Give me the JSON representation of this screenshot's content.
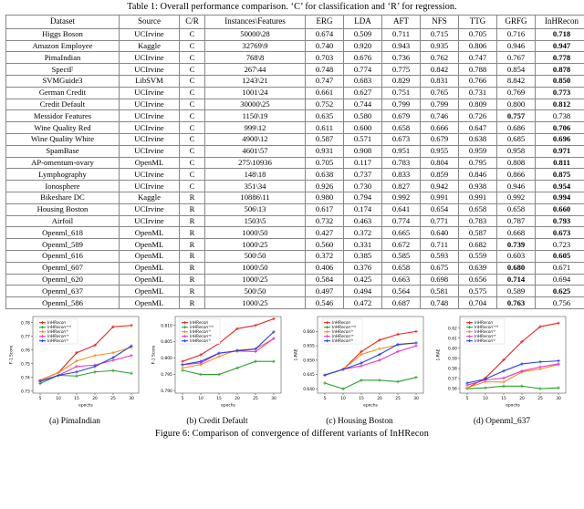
{
  "table": {
    "caption": "Table 1: Overall performance comparison. ‘C’ for classification and ‘R’ for regression.",
    "columns": [
      "Dataset",
      "Source",
      "C/R",
      "Instances\\Features",
      "ERG",
      "LDA",
      "AFT",
      "NFS",
      "TTG",
      "GRFG",
      "InHRecon"
    ],
    "rows": [
      {
        "cells": [
          "Higgs Boson",
          "UCIrvine",
          "C",
          "50000\\28",
          "0.674",
          "0.509",
          "0.711",
          "0.715",
          "0.705",
          "0.716",
          "0.718"
        ],
        "bold": [
          10
        ]
      },
      {
        "cells": [
          "Amazon Employee",
          "Kaggle",
          "C",
          "32769\\9",
          "0.740",
          "0.920",
          "0.943",
          "0.935",
          "0.806",
          "0.946",
          "0.947"
        ],
        "bold": [
          10
        ]
      },
      {
        "cells": [
          "PimaIndian",
          "UCIrvine",
          "C",
          "768\\8",
          "0.703",
          "0.676",
          "0.736",
          "0.762",
          "0.747",
          "0.767",
          "0.778"
        ],
        "bold": [
          10
        ]
      },
      {
        "cells": [
          "SpectF",
          "UCIrvine",
          "C",
          "267\\44",
          "0.748",
          "0.774",
          "0.775",
          "0.842",
          "0.788",
          "0.854",
          "0.878"
        ],
        "bold": [
          10
        ]
      },
      {
        "cells": [
          "SVMGuide3",
          "LibSVM",
          "C",
          "1243\\21",
          "0.747",
          "0.683",
          "0.829",
          "0.831",
          "0.766",
          "8.842",
          "0.850"
        ],
        "bold": [
          10
        ]
      },
      {
        "cells": [
          "German Credit",
          "UCIrvine",
          "C",
          "1001\\24",
          "0.661",
          "0.627",
          "0.751",
          "0.765",
          "0.731",
          "0.769",
          "0.773"
        ],
        "bold": [
          10
        ]
      },
      {
        "cells": [
          "Credit Default",
          "UCIrvine",
          "C",
          "30000\\25",
          "0.752",
          "0.744",
          "0.799",
          "0.799",
          "0.809",
          "0.800",
          "0.812"
        ],
        "bold": [
          10
        ]
      },
      {
        "cells": [
          "Messidor Features",
          "UCIrvine",
          "C",
          "1150\\19",
          "0.635",
          "0.580",
          "0.679",
          "0.746",
          "0.726",
          "0.757",
          "0.738"
        ],
        "bold": [
          9
        ]
      },
      {
        "cells": [
          "Wine Quality Red",
          "UCIrvine",
          "C",
          "999\\12",
          "0.611",
          "0.600",
          "0.658",
          "0.666",
          "0.647",
          "0.686",
          "0.706"
        ],
        "bold": [
          10
        ]
      },
      {
        "cells": [
          "Wine Quality White",
          "UCIrvine",
          "C",
          "4900\\12",
          "0.587",
          "0.571",
          "0.673",
          "0.679",
          "0.638",
          "0.685",
          "0.696"
        ],
        "bold": [
          10
        ]
      },
      {
        "cells": [
          "SpamBase",
          "UCIrvine",
          "C",
          "4601\\57",
          "0.931",
          "0.908",
          "0.951",
          "0.955",
          "0.959",
          "0.958",
          "0.971"
        ],
        "bold": [
          10
        ]
      },
      {
        "cells": [
          "AP-omentum-ovary",
          "OpenML",
          "C",
          "275\\10936",
          "0.705",
          "0.117",
          "0.783",
          "0.804",
          "0.795",
          "0.808",
          "0.811"
        ],
        "bold": [
          10
        ]
      },
      {
        "cells": [
          "Lymphography",
          "UCIrvine",
          "C",
          "148\\18",
          "0.638",
          "0.737",
          "0.833",
          "0.859",
          "0.846",
          "0.866",
          "0.875"
        ],
        "bold": [
          10
        ]
      },
      {
        "cells": [
          "Ionosphere",
          "UCIrvine",
          "C",
          "351\\34",
          "0.926",
          "0.730",
          "0.827",
          "0.942",
          "0.938",
          "0.946",
          "0.954"
        ],
        "bold": [
          10
        ]
      },
      {
        "cells": [
          "Bikeshare DC",
          "Kaggle",
          "R",
          "10886\\11",
          "0.980",
          "0.794",
          "0.992",
          "0.991",
          "0.991",
          "0.992",
          "0.994"
        ],
        "bold": [
          10
        ]
      },
      {
        "cells": [
          "Housing Boston",
          "UCIrvine",
          "R",
          "506\\13",
          "0.617",
          "0.174",
          "0.641",
          "0.654",
          "0.658",
          "0.658",
          "0.660"
        ],
        "bold": [
          10
        ]
      },
      {
        "cells": [
          "Airfoil",
          "UCIrvine",
          "R",
          "1503\\5",
          "0.732",
          "0.463",
          "0.774",
          "0.771",
          "0.783",
          "0.787",
          "0.793"
        ],
        "bold": [
          10
        ]
      },
      {
        "cells": [
          "Openml_618",
          "OpenML",
          "R",
          "1000\\50",
          "0.427",
          "0.372",
          "0.665",
          "0.640",
          "0.587",
          "0.668",
          "0.673"
        ],
        "bold": [
          10
        ]
      },
      {
        "cells": [
          "Openml_589",
          "OpenML",
          "R",
          "1000\\25",
          "0.560",
          "0.331",
          "0.672",
          "0.711",
          "0.682",
          "0.739",
          "0.723"
        ],
        "bold": [
          9
        ]
      },
      {
        "cells": [
          "Openml_616",
          "OpenML",
          "R",
          "500\\50",
          "0.372",
          "0.385",
          "0.585",
          "0.593",
          "0.559",
          "0.603",
          "0.605"
        ],
        "bold": [
          10
        ]
      },
      {
        "cells": [
          "Openml_607",
          "OpenML",
          "R",
          "1000\\50",
          "0.406",
          "0.376",
          "0.658",
          "0.675",
          "0.639",
          "0.680",
          "0.671"
        ],
        "bold": [
          9
        ]
      },
      {
        "cells": [
          "Openml_620",
          "OpenML",
          "R",
          "1000\\25",
          "0.584",
          "0.425",
          "0.663",
          "0.698",
          "0.656",
          "0.714",
          "0.694"
        ],
        "bold": [
          9
        ]
      },
      {
        "cells": [
          "Openml_637",
          "OpenML",
          "R",
          "500\\50",
          "0.497",
          "0.494",
          "0.564",
          "0.581",
          "0.575",
          "0.589",
          "0.625"
        ],
        "bold": [
          10
        ]
      },
      {
        "cells": [
          "Openml_586",
          "OpenML",
          "R",
          "1000\\25",
          "0.546",
          "0.472",
          "0.687",
          "0.748",
          "0.704",
          "0.763",
          "0.756"
        ],
        "bold": [
          9
        ]
      }
    ]
  },
  "figure": {
    "caption": "Figure 6: Comparison of convergence of different variants of InHRecon",
    "subcaptions": [
      "(a) PimaIndian",
      "(b) Credit Default",
      "(c) Housing Boston",
      "(d) Openml_637"
    ]
  },
  "legend": {
    "entries": [
      {
        "base": "InHRecon",
        "sup": "",
        "color": "#ee2222"
      },
      {
        "base": "InHRecon",
        "sup": "-rnd",
        "color": "#2ca02c"
      },
      {
        "base": "InHRecon",
        "sup": "-h",
        "color": "#f0921e"
      },
      {
        "base": "InHRecon",
        "sup": "-w",
        "color": "#ee33cc"
      },
      {
        "base": "InHRecon",
        "sup": "-b",
        "color": "#2244dd"
      }
    ]
  },
  "chart_data": [
    {
      "type": "line",
      "title": "(a) PimaIndian",
      "xlabel": "epochs",
      "ylabel": "F-1 Score",
      "x": [
        5,
        10,
        15,
        20,
        25,
        30
      ],
      "xlim": [
        3,
        32
      ],
      "ylim": [
        0.7285,
        0.7845
      ],
      "yticks": [
        0.73,
        0.74,
        0.75,
        0.76,
        0.77,
        0.78
      ],
      "ytick_labels": [
        "0.73",
        "0.74",
        "0.75",
        "0.76",
        "0.77",
        "0.78"
      ],
      "xticks": [
        5,
        10,
        15,
        20,
        25,
        30
      ],
      "grid": false,
      "legend_position": "upper left",
      "series": [
        {
          "name": "InHRecon",
          "color": "#ee2222",
          "values": [
            0.738,
            0.7435,
            0.758,
            0.7635,
            0.777,
            0.778
          ]
        },
        {
          "name": "InHRecon-rnd",
          "color": "#2ca02c",
          "values": [
            0.7355,
            0.7415,
            0.741,
            0.744,
            0.745,
            0.743
          ]
        },
        {
          "name": "InHRecon-h",
          "color": "#f0921e",
          "values": [
            0.738,
            0.7435,
            0.752,
            0.756,
            0.758,
            0.762
          ]
        },
        {
          "name": "InHRecon-w",
          "color": "#ee33cc",
          "values": [
            0.7375,
            0.7415,
            0.748,
            0.749,
            0.7525,
            0.756
          ]
        },
        {
          "name": "InHRecon-b",
          "color": "#2244dd",
          "values": [
            0.737,
            0.7415,
            0.744,
            0.748,
            0.7545,
            0.763
          ]
        }
      ]
    },
    {
      "type": "line",
      "title": "(b) Credit Default",
      "xlabel": "epochs",
      "ylabel": "F-1 Score",
      "x": [
        5,
        10,
        15,
        20,
        25,
        30
      ],
      "xlim": [
        3,
        32
      ],
      "ylim": [
        0.7893,
        0.8127
      ],
      "yticks": [
        0.79,
        0.795,
        0.8,
        0.805,
        0.81
      ],
      "ytick_labels": [
        "0.790",
        "0.795",
        "0.800",
        "0.805",
        "0.810"
      ],
      "xticks": [
        5,
        10,
        15,
        20,
        25,
        30
      ],
      "grid": false,
      "legend_position": "upper left",
      "series": [
        {
          "name": "InHRecon",
          "color": "#ee2222",
          "values": [
            0.799,
            0.801,
            0.8045,
            0.809,
            0.81,
            0.812
          ]
        },
        {
          "name": "InHRecon-rnd",
          "color": "#2ca02c",
          "values": [
            0.7963,
            0.795,
            0.795,
            0.797,
            0.799,
            0.799
          ]
        },
        {
          "name": "InHRecon-h",
          "color": "#f0921e",
          "values": [
            0.797,
            0.798,
            0.8005,
            0.8025,
            0.8028,
            0.806
          ]
        },
        {
          "name": "InHRecon-w",
          "color": "#ee33cc",
          "values": [
            0.798,
            0.7985,
            0.8015,
            0.8022,
            0.802,
            0.806
          ]
        },
        {
          "name": "InHRecon-b",
          "color": "#2244dd",
          "values": [
            0.798,
            0.799,
            0.8015,
            0.8022,
            0.8028,
            0.808
          ]
        }
      ]
    },
    {
      "type": "line",
      "title": "(c) Housing Boston",
      "xlabel": "epochs",
      "ylabel": "1-RAE",
      "x": [
        5,
        10,
        15,
        20,
        25,
        30
      ],
      "xlim": [
        3,
        32
      ],
      "ylim": [
        0.6385,
        0.6652
      ],
      "yticks": [
        0.64,
        0.645,
        0.65,
        0.655,
        0.66
      ],
      "ytick_labels": [
        "0.640",
        "0.645",
        "0.650",
        "0.655",
        "0.660"
      ],
      "xticks": [
        5,
        10,
        15,
        20,
        25,
        30
      ],
      "grid": false,
      "legend_position": "upper left",
      "series": [
        {
          "name": "InHRecon",
          "color": "#ee2222",
          "values": [
            0.6448,
            0.6468,
            0.653,
            0.657,
            0.659,
            0.66
          ]
        },
        {
          "name": "InHRecon-rnd",
          "color": "#2ca02c",
          "values": [
            0.642,
            0.64,
            0.643,
            0.643,
            0.6425,
            0.644
          ]
        },
        {
          "name": "InHRecon-h",
          "color": "#f0921e",
          "values": [
            0.6448,
            0.6468,
            0.652,
            0.654,
            0.6553,
            0.656
          ]
        },
        {
          "name": "InHRecon-w",
          "color": "#ee33cc",
          "values": [
            0.6448,
            0.6468,
            0.648,
            0.65,
            0.653,
            0.655
          ]
        },
        {
          "name": "InHRecon-b",
          "color": "#2244dd",
          "values": [
            0.6448,
            0.6468,
            0.649,
            0.652,
            0.6555,
            0.656
          ]
        }
      ]
    },
    {
      "type": "line",
      "title": "(d) Openml_637",
      "xlabel": "epochs",
      "ylabel": "1-RAE",
      "x": [
        5,
        10,
        15,
        20,
        25,
        30
      ],
      "xlim": [
        3,
        32
      ],
      "ylim": [
        0.5555,
        0.6315
      ],
      "yticks": [
        0.56,
        0.57,
        0.58,
        0.59,
        0.6,
        0.61,
        0.62
      ],
      "ytick_labels": [
        "0.56",
        "0.57",
        "0.58",
        "0.59",
        "0.60",
        "0.61",
        "0.62"
      ],
      "xticks": [
        5,
        10,
        15,
        20,
        25,
        30
      ],
      "grid": false,
      "legend_position": "upper left",
      "series": [
        {
          "name": "InHRecon",
          "color": "#ee2222",
          "values": [
            0.5605,
            0.5705,
            0.5885,
            0.6065,
            0.6215,
            0.625
          ]
        },
        {
          "name": "InHRecon-rnd",
          "color": "#2ca02c",
          "values": [
            0.56,
            0.5608,
            0.5625,
            0.5625,
            0.56,
            0.5608
          ]
        },
        {
          "name": "InHRecon-h",
          "color": "#f0921e",
          "values": [
            0.5608,
            0.5668,
            0.5665,
            0.5765,
            0.5795,
            0.5838
          ]
        },
        {
          "name": "InHRecon-w",
          "color": "#ee33cc",
          "values": [
            0.5635,
            0.5685,
            0.5705,
            0.5775,
            0.5815,
            0.5845
          ]
        },
        {
          "name": "InHRecon-b",
          "color": "#2244dd",
          "values": [
            0.5655,
            0.5695,
            0.5775,
            0.5845,
            0.5865,
            0.5875
          ]
        }
      ]
    }
  ]
}
